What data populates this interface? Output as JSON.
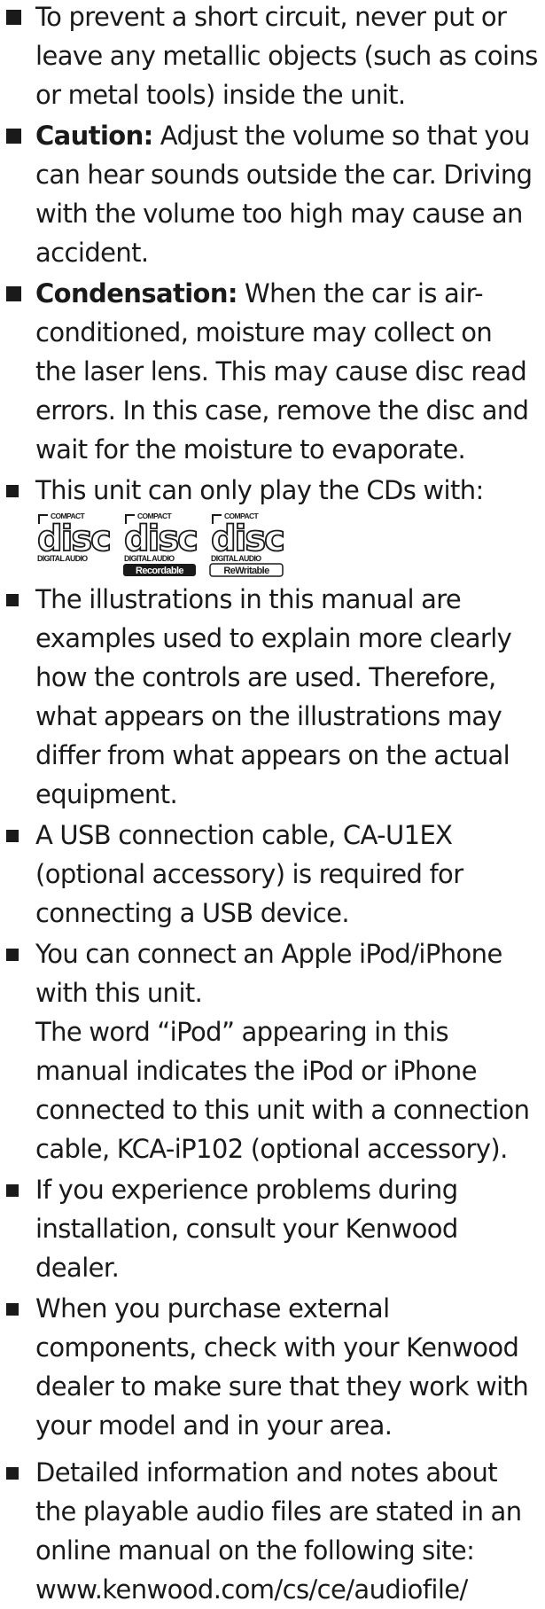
{
  "items": [
    {
      "text": "To prevent a short circuit, never put or leave any metallic objects (such as coins or metal tools) inside the unit."
    },
    {
      "bold": "Caution:",
      "text": " Adjust the volume so that you can hear sounds outside the car. Driving with the volume too high may cause an accident."
    },
    {
      "bold": "Condensation:",
      "text": " When the car is air-conditioned, moisture may collect on the laser lens. This may cause disc read errors. In this case, remove the disc and wait for the moisture to evaporate."
    },
    {
      "text": "This unit can only play the CDs with:"
    },
    {
      "text": "The illustrations in this manual are examples used to explain more clearly how the controls are used. Therefore, what appears on the illustrations may differ from what appears on the actual equipment."
    },
    {
      "text": "A USB connection cable, CA-U1EX (optional accessory) is required for connecting a USB device."
    },
    {
      "text": "You can connect an Apple iPod/iPhone with this unit.",
      "text2": "The word “iPod” appearing in this manual indicates the iPod or iPhone connected to this unit with a connection cable, KCA-iP102 (optional accessory)."
    },
    {
      "text": "If you experience problems during installation, consult your Kenwood dealer."
    },
    {
      "text": "When you purchase external components, check with your Kenwood dealer to make sure that they work with your model and in your area."
    },
    {
      "text": "Detailed information and notes about the playable audio files are stated in an online manual on the following site:",
      "url": "www.kenwood.com/cs/ce/audiofile/"
    }
  ],
  "logos": [
    {
      "top": "COMPACT",
      "word": "disc",
      "bottom": "DIGITAL AUDIO",
      "tag": ""
    },
    {
      "top": "COMPACT",
      "word": "disc",
      "bottom": "DIGITAL AUDIO",
      "tag": "Recordable"
    },
    {
      "top": "COMPACT",
      "word": "disc",
      "bottom": "DIGITAL AUDIO",
      "tag": "ReWritable"
    }
  ]
}
